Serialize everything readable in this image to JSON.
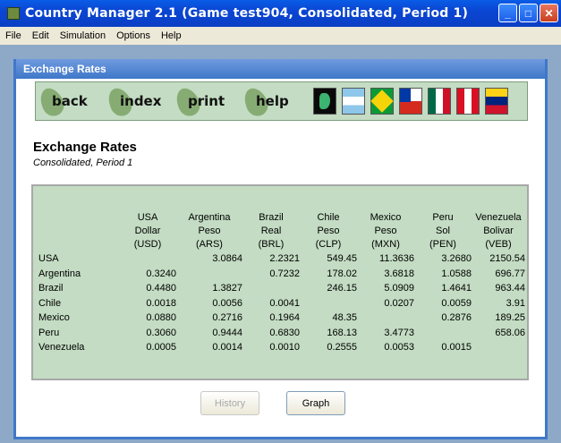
{
  "window": {
    "title": "Country Manager 2.1 (Game test904, Consolidated, Period 1)",
    "minimize": "_",
    "maximize": "□",
    "close": "✕"
  },
  "menu": [
    "File",
    "Edit",
    "Simulation",
    "Options",
    "Help"
  ],
  "dialog": {
    "title": "Exchange Rates",
    "nav": [
      "back",
      "index",
      "print",
      "help"
    ],
    "flags": [
      "world-map-icon",
      "argentina-flag-icon",
      "brazil-flag-icon",
      "chile-flag-icon",
      "mexico-flag-icon",
      "peru-flag-icon",
      "venezuela-flag-icon"
    ],
    "heading": "Exchange Rates",
    "subheading": "Consolidated, Period 1",
    "table": {
      "columns": [
        [
          "USA",
          "Dollar",
          "(USD)"
        ],
        [
          "Argentina",
          "Peso",
          "(ARS)"
        ],
        [
          "Brazil",
          "Real",
          "(BRL)"
        ],
        [
          "Chile",
          "Peso",
          "(CLP)"
        ],
        [
          "Mexico",
          "Peso",
          "(MXN)"
        ],
        [
          "Peru",
          "Sol",
          "(PEN)"
        ],
        [
          "Venezuela",
          "Bolivar",
          "(VEB)"
        ]
      ],
      "rows": [
        {
          "label": "USA",
          "cells": [
            "",
            "3.0864",
            "2.2321",
            "549.45",
            "11.3636",
            "3.2680",
            "2150.54"
          ]
        },
        {
          "label": "Argentina",
          "cells": [
            "0.3240",
            "",
            "0.7232",
            "178.02",
            "3.6818",
            "1.0588",
            "696.77"
          ]
        },
        {
          "label": "Brazil",
          "cells": [
            "0.4480",
            "1.3827",
            "",
            "246.15",
            "5.0909",
            "1.4641",
            "963.44"
          ]
        },
        {
          "label": "Chile",
          "cells": [
            "0.0018",
            "0.0056",
            "0.0041",
            "",
            "0.0207",
            "0.0059",
            "3.91"
          ]
        },
        {
          "label": "Mexico",
          "cells": [
            "0.0880",
            "0.2716",
            "0.1964",
            "48.35",
            "",
            "0.2876",
            "189.25"
          ]
        },
        {
          "label": "Peru",
          "cells": [
            "0.3060",
            "0.9444",
            "0.6830",
            "168.13",
            "3.4773",
            "",
            "658.06"
          ]
        },
        {
          "label": "Venezuela",
          "cells": [
            "0.0005",
            "0.0014",
            "0.0010",
            "0.2555",
            "0.0053",
            "0.0015",
            ""
          ]
        }
      ]
    },
    "buttons": {
      "history": "History",
      "graph": "Graph"
    }
  }
}
